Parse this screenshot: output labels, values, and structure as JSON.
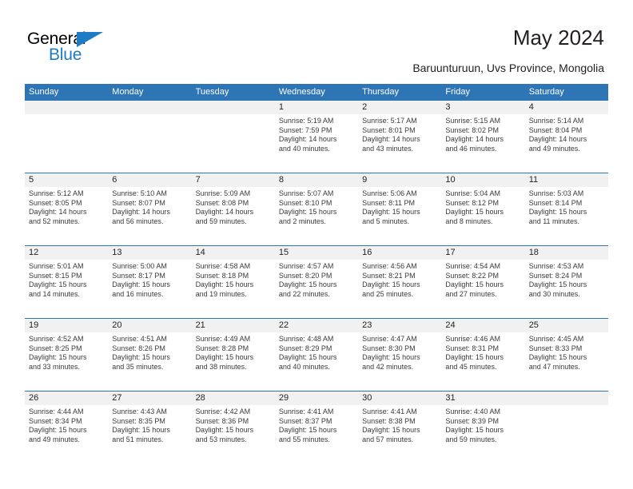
{
  "logo": {
    "word_top": "General",
    "word_bottom": "Blue",
    "triangle_color": "#1d7cc4",
    "icon": "triangle-icon"
  },
  "header": {
    "title": "May 2024",
    "subtitle": "Baruunturuun, Uvs Province, Mongolia"
  },
  "colors": {
    "header_blue": "#2e75b6",
    "datebar_gray": "#f1f1f1",
    "text": "#231f20",
    "logo_blue": "#1d7cc4"
  },
  "calendar": {
    "weekdays": [
      "Sunday",
      "Monday",
      "Tuesday",
      "Wednesday",
      "Thursday",
      "Friday",
      "Saturday"
    ],
    "weeks": [
      [
        {
          "day": "",
          "sunrise": "",
          "sunset": "",
          "daylight1": "",
          "daylight2": ""
        },
        {
          "day": "",
          "sunrise": "",
          "sunset": "",
          "daylight1": "",
          "daylight2": ""
        },
        {
          "day": "",
          "sunrise": "",
          "sunset": "",
          "daylight1": "",
          "daylight2": ""
        },
        {
          "day": "1",
          "sunrise": "Sunrise: 5:19 AM",
          "sunset": "Sunset: 7:59 PM",
          "daylight1": "Daylight: 14 hours",
          "daylight2": "and 40 minutes."
        },
        {
          "day": "2",
          "sunrise": "Sunrise: 5:17 AM",
          "sunset": "Sunset: 8:01 PM",
          "daylight1": "Daylight: 14 hours",
          "daylight2": "and 43 minutes."
        },
        {
          "day": "3",
          "sunrise": "Sunrise: 5:15 AM",
          "sunset": "Sunset: 8:02 PM",
          "daylight1": "Daylight: 14 hours",
          "daylight2": "and 46 minutes."
        },
        {
          "day": "4",
          "sunrise": "Sunrise: 5:14 AM",
          "sunset": "Sunset: 8:04 PM",
          "daylight1": "Daylight: 14 hours",
          "daylight2": "and 49 minutes."
        }
      ],
      [
        {
          "day": "5",
          "sunrise": "Sunrise: 5:12 AM",
          "sunset": "Sunset: 8:05 PM",
          "daylight1": "Daylight: 14 hours",
          "daylight2": "and 52 minutes."
        },
        {
          "day": "6",
          "sunrise": "Sunrise: 5:10 AM",
          "sunset": "Sunset: 8:07 PM",
          "daylight1": "Daylight: 14 hours",
          "daylight2": "and 56 minutes."
        },
        {
          "day": "7",
          "sunrise": "Sunrise: 5:09 AM",
          "sunset": "Sunset: 8:08 PM",
          "daylight1": "Daylight: 14 hours",
          "daylight2": "and 59 minutes."
        },
        {
          "day": "8",
          "sunrise": "Sunrise: 5:07 AM",
          "sunset": "Sunset: 8:10 PM",
          "daylight1": "Daylight: 15 hours",
          "daylight2": "and 2 minutes."
        },
        {
          "day": "9",
          "sunrise": "Sunrise: 5:06 AM",
          "sunset": "Sunset: 8:11 PM",
          "daylight1": "Daylight: 15 hours",
          "daylight2": "and 5 minutes."
        },
        {
          "day": "10",
          "sunrise": "Sunrise: 5:04 AM",
          "sunset": "Sunset: 8:12 PM",
          "daylight1": "Daylight: 15 hours",
          "daylight2": "and 8 minutes."
        },
        {
          "day": "11",
          "sunrise": "Sunrise: 5:03 AM",
          "sunset": "Sunset: 8:14 PM",
          "daylight1": "Daylight: 15 hours",
          "daylight2": "and 11 minutes."
        }
      ],
      [
        {
          "day": "12",
          "sunrise": "Sunrise: 5:01 AM",
          "sunset": "Sunset: 8:15 PM",
          "daylight1": "Daylight: 15 hours",
          "daylight2": "and 14 minutes."
        },
        {
          "day": "13",
          "sunrise": "Sunrise: 5:00 AM",
          "sunset": "Sunset: 8:17 PM",
          "daylight1": "Daylight: 15 hours",
          "daylight2": "and 16 minutes."
        },
        {
          "day": "14",
          "sunrise": "Sunrise: 4:58 AM",
          "sunset": "Sunset: 8:18 PM",
          "daylight1": "Daylight: 15 hours",
          "daylight2": "and 19 minutes."
        },
        {
          "day": "15",
          "sunrise": "Sunrise: 4:57 AM",
          "sunset": "Sunset: 8:20 PM",
          "daylight1": "Daylight: 15 hours",
          "daylight2": "and 22 minutes."
        },
        {
          "day": "16",
          "sunrise": "Sunrise: 4:56 AM",
          "sunset": "Sunset: 8:21 PM",
          "daylight1": "Daylight: 15 hours",
          "daylight2": "and 25 minutes."
        },
        {
          "day": "17",
          "sunrise": "Sunrise: 4:54 AM",
          "sunset": "Sunset: 8:22 PM",
          "daylight1": "Daylight: 15 hours",
          "daylight2": "and 27 minutes."
        },
        {
          "day": "18",
          "sunrise": "Sunrise: 4:53 AM",
          "sunset": "Sunset: 8:24 PM",
          "daylight1": "Daylight: 15 hours",
          "daylight2": "and 30 minutes."
        }
      ],
      [
        {
          "day": "19",
          "sunrise": "Sunrise: 4:52 AM",
          "sunset": "Sunset: 8:25 PM",
          "daylight1": "Daylight: 15 hours",
          "daylight2": "and 33 minutes."
        },
        {
          "day": "20",
          "sunrise": "Sunrise: 4:51 AM",
          "sunset": "Sunset: 8:26 PM",
          "daylight1": "Daylight: 15 hours",
          "daylight2": "and 35 minutes."
        },
        {
          "day": "21",
          "sunrise": "Sunrise: 4:49 AM",
          "sunset": "Sunset: 8:28 PM",
          "daylight1": "Daylight: 15 hours",
          "daylight2": "and 38 minutes."
        },
        {
          "day": "22",
          "sunrise": "Sunrise: 4:48 AM",
          "sunset": "Sunset: 8:29 PM",
          "daylight1": "Daylight: 15 hours",
          "daylight2": "and 40 minutes."
        },
        {
          "day": "23",
          "sunrise": "Sunrise: 4:47 AM",
          "sunset": "Sunset: 8:30 PM",
          "daylight1": "Daylight: 15 hours",
          "daylight2": "and 42 minutes."
        },
        {
          "day": "24",
          "sunrise": "Sunrise: 4:46 AM",
          "sunset": "Sunset: 8:31 PM",
          "daylight1": "Daylight: 15 hours",
          "daylight2": "and 45 minutes."
        },
        {
          "day": "25",
          "sunrise": "Sunrise: 4:45 AM",
          "sunset": "Sunset: 8:33 PM",
          "daylight1": "Daylight: 15 hours",
          "daylight2": "and 47 minutes."
        }
      ],
      [
        {
          "day": "26",
          "sunrise": "Sunrise: 4:44 AM",
          "sunset": "Sunset: 8:34 PM",
          "daylight1": "Daylight: 15 hours",
          "daylight2": "and 49 minutes."
        },
        {
          "day": "27",
          "sunrise": "Sunrise: 4:43 AM",
          "sunset": "Sunset: 8:35 PM",
          "daylight1": "Daylight: 15 hours",
          "daylight2": "and 51 minutes."
        },
        {
          "day": "28",
          "sunrise": "Sunrise: 4:42 AM",
          "sunset": "Sunset: 8:36 PM",
          "daylight1": "Daylight: 15 hours",
          "daylight2": "and 53 minutes."
        },
        {
          "day": "29",
          "sunrise": "Sunrise: 4:41 AM",
          "sunset": "Sunset: 8:37 PM",
          "daylight1": "Daylight: 15 hours",
          "daylight2": "and 55 minutes."
        },
        {
          "day": "30",
          "sunrise": "Sunrise: 4:41 AM",
          "sunset": "Sunset: 8:38 PM",
          "daylight1": "Daylight: 15 hours",
          "daylight2": "and 57 minutes."
        },
        {
          "day": "31",
          "sunrise": "Sunrise: 4:40 AM",
          "sunset": "Sunset: 8:39 PM",
          "daylight1": "Daylight: 15 hours",
          "daylight2": "and 59 minutes."
        },
        {
          "day": "",
          "sunrise": "",
          "sunset": "",
          "daylight1": "",
          "daylight2": ""
        }
      ]
    ]
  }
}
